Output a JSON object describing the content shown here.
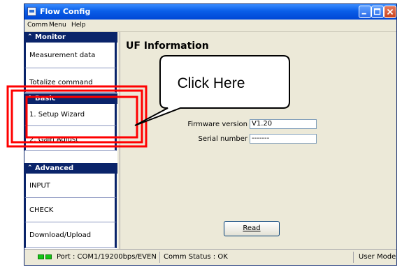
{
  "window": {
    "title": "Flow Config"
  },
  "menu": [
    "Comm",
    "Menu",
    "Help"
  ],
  "sidebar": {
    "sections": [
      {
        "label": "Monitor",
        "items": [
          "Measurement data",
          "Totalize command"
        ]
      },
      {
        "label": "Basic",
        "items": [
          "1. Setup Wizard",
          "2. Gain Adjust"
        ]
      },
      {
        "label": "Advanced",
        "items": [
          "INPUT",
          "CHECK",
          "Download/Upload"
        ]
      }
    ]
  },
  "main": {
    "title": "UF Information",
    "fields": [
      {
        "label": "Firmware version",
        "value": "V1.20"
      },
      {
        "label": "Serial number",
        "value": "-------"
      }
    ],
    "read_button": "Read"
  },
  "callout": {
    "text": "Click Here"
  },
  "status": {
    "port": "Port : COM1/19200bps/EVEN",
    "comm": "Comm Status : OK",
    "mode": "User Mode"
  },
  "colors": {
    "title_bar": "#0a5ee8",
    "nav_header": "#0a246a",
    "highlight": "#ff0000",
    "led": "#14c414"
  }
}
